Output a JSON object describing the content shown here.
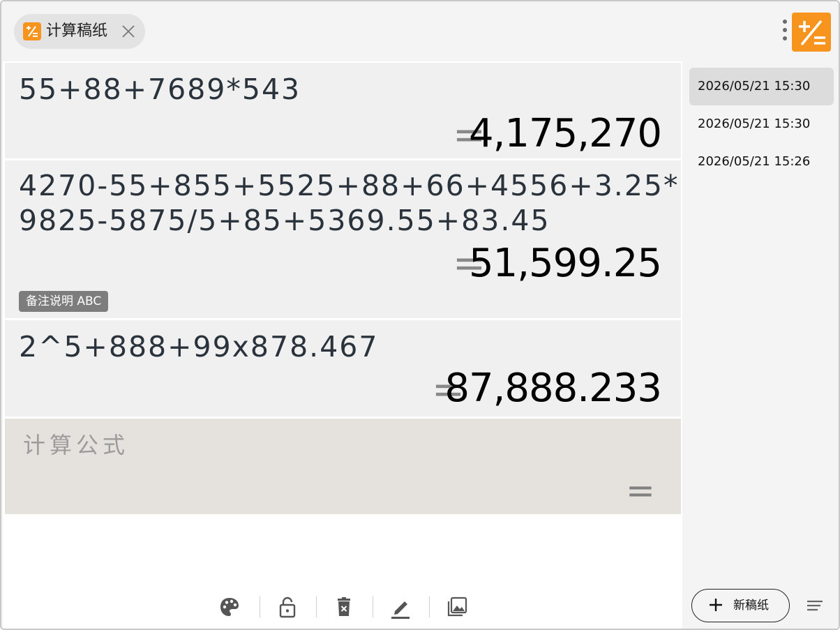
{
  "tab": {
    "label": "计算稿纸",
    "close": "×"
  },
  "app": {
    "accent_color": "#f7941d"
  },
  "calculations": [
    {
      "expression_lines": [
        "55+88+7689*543"
      ],
      "equals": "=",
      "result": "4,175,270",
      "note": ""
    },
    {
      "expression_lines": [
        "4270-55+855+5525+88+66+4556+3.25*",
        "9825-5875/5+85+5369.55+83.45"
      ],
      "equals": "=",
      "result": "51,599.25",
      "note": "备注说明 ABC"
    },
    {
      "expression_lines": [
        "2^5+888+99x878.467"
      ],
      "equals": "=",
      "result": "87,888.233",
      "note": ""
    }
  ],
  "input": {
    "placeholder": "计算公式",
    "equals": "="
  },
  "toolbar": {
    "icons": [
      "palette-icon",
      "lock-icon",
      "delete-icon",
      "edit-icon",
      "image-icon"
    ]
  },
  "history": [
    {
      "label": "2026/05/21 15:30",
      "active": true
    },
    {
      "label": "2026/05/21 15:30",
      "active": false
    },
    {
      "label": "2026/05/21 15:26",
      "active": false
    }
  ],
  "new_sheet": {
    "label": "新稿纸"
  }
}
